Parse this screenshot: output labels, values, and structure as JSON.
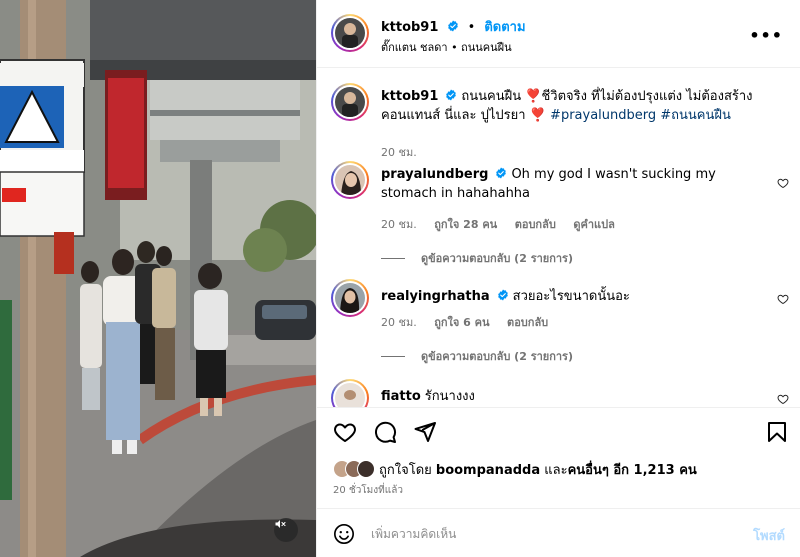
{
  "post": {
    "author": "kttob91",
    "follow_label": "ติดตาม",
    "location": "ตั๊กแตน ชลดา • ถนนคนฝืน",
    "more_label": "•••",
    "caption_user": "kttob91",
    "caption_text": "ถนนคนฝืน ❣️ชีวิตจริง ที่ไม่ต้องปรุงแต่ง ไม่ต้องสร้างคอนแทนส์ นี่และ ปูไปรยา ❣️ ",
    "caption_tags": "#prayalundberg #ถนนคนฝืน",
    "caption_time": "20 ชม."
  },
  "comments": [
    {
      "user": "prayalundberg",
      "verified": true,
      "text": "Oh my god I wasn't sucking my stomach in hahahahha",
      "time": "20 ชม.",
      "likes": "ถูกใจ 28 คน",
      "reply": "ตอบกลับ",
      "translate": "ดูคำแปล",
      "replies_label": "ดูข้อความตอบกลับ (2 รายการ)"
    },
    {
      "user": "realyingrhatha",
      "verified": true,
      "text": "สวยอะไรขนาดนั้นอะ",
      "time": "20 ชม.",
      "likes": "ถูกใจ 6 คน",
      "reply": "ตอบกลับ",
      "replies_label": "ดูข้อความตอบกลับ (2 รายการ)"
    },
    {
      "user": "fiatto",
      "verified": false,
      "text": "รักนางงง"
    }
  ],
  "engagement": {
    "liked_by_prefix": "ถูกใจโดย ",
    "liked_by_user": "boompanadda",
    "liked_by_suffix_1": " และ",
    "liked_by_others": "คนอื่นๆ อีก 1,213 คน",
    "time_ago": "20 ชั่วโมงที่แล้ว"
  },
  "composer": {
    "placeholder": "เพิ่มความคิดเห็น",
    "post_label": "โพสต์"
  },
  "icons": {
    "like": "heart-icon",
    "comment": "comment-icon",
    "share": "share-icon",
    "save": "bookmark-icon",
    "emoji": "emoji-icon",
    "mute": "speaker-muted-icon",
    "more": "more-options-icon"
  },
  "colors": {
    "follow": "#0095f6",
    "verified": "#0095f6",
    "hashtag": "#00376b",
    "secondary_text": "#737373",
    "post_disabled": "#b3dbff",
    "heart_emoji": "#d0021b"
  }
}
